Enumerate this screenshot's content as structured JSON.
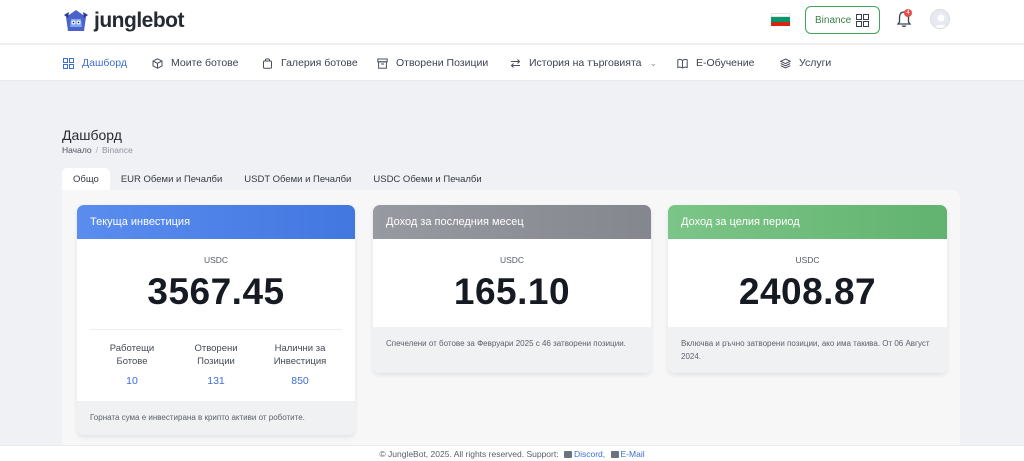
{
  "brand": {
    "name": "junglebot"
  },
  "topbar": {
    "exchange_label": "Binance",
    "notification_count": "4",
    "flag_colors": [
      "#ffffff",
      "#00966e",
      "#d62612"
    ]
  },
  "nav": {
    "items": [
      {
        "label": "Дашборд",
        "icon": "dashboard-grid-icon",
        "active": true
      },
      {
        "label": "Моите ботове",
        "icon": "cube-icon"
      },
      {
        "label": "Галерия ботове",
        "icon": "bag-icon"
      },
      {
        "label": "Отворени Позиции",
        "icon": "archive-icon"
      },
      {
        "label": "История на търговията",
        "icon": "swap-icon",
        "dropdown": true
      },
      {
        "label": "Е-Обучение",
        "icon": "book-icon"
      },
      {
        "label": "Услуги",
        "icon": "layers-icon"
      }
    ]
  },
  "page": {
    "title": "Дашборд",
    "breadcrumb": {
      "home": "Начало",
      "current": "Binance"
    }
  },
  "tabs": [
    {
      "label": "Общо",
      "active": true
    },
    {
      "label": "EUR Обеми и Печалби"
    },
    {
      "label": "USDT Обеми и Печалби"
    },
    {
      "label": "USDC Обеми и Печалби"
    }
  ],
  "cards": {
    "investment": {
      "title": "Текуща инвестиция",
      "currency": "USDC",
      "value": "3567.45",
      "stats": [
        {
          "label_line1": "Работещи",
          "label_line2": "Ботове",
          "value": "10"
        },
        {
          "label_line1": "Отворени",
          "label_line2": "Позиции",
          "value": "131"
        },
        {
          "label_line1": "Налични за",
          "label_line2": "Инвестиция",
          "value": "850"
        }
      ],
      "footer": "Горната сума е инвестирана в крипто активи от роботите.",
      "color": "#4d83e8"
    },
    "last_month": {
      "title": "Доход за последния месец",
      "currency": "USDC",
      "value": "165.10",
      "footer": "Спечелени от ботове за Февруари 2025 с 46 затворени позиции.",
      "color": "#8a8d93"
    },
    "total": {
      "title": "Доход за целия период",
      "currency": "USDC",
      "value": "2408.87",
      "footer": "Включва и ръчно затворени позиции, ако има такива. От 06 Август 2024.",
      "color": "#6cbb78"
    }
  },
  "footer": {
    "text": "© JungleBot, 2025. All rights reserved. Support:",
    "discord": "Discord,",
    "email": "E-Mail"
  }
}
